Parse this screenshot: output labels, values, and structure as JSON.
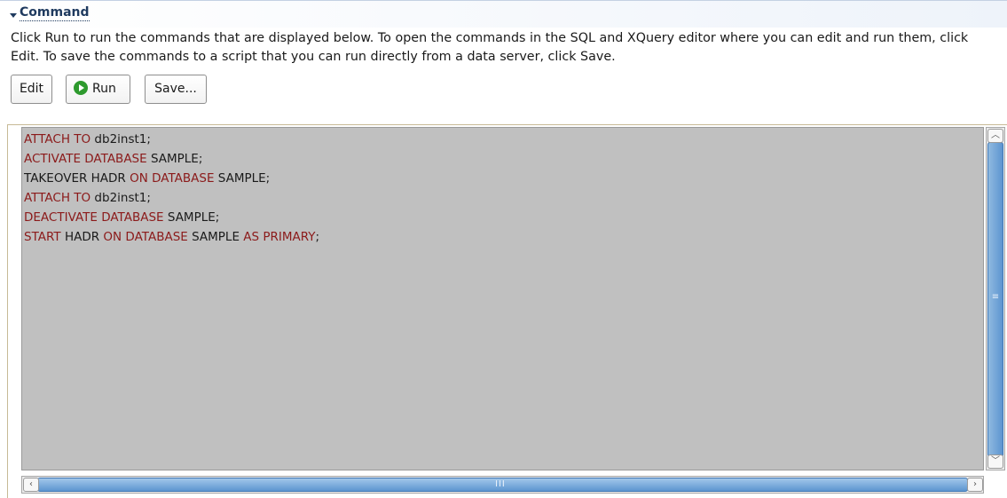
{
  "section": {
    "title": "Command",
    "description": "Click Run to run the commands that are displayed below. To open the commands in the SQL and XQuery editor where you can edit and run them, click Edit. To save the commands to a script that you can run directly from a data server, click Save."
  },
  "buttons": {
    "edit": "Edit",
    "run": "Run",
    "save": "Save..."
  },
  "colors": {
    "keyword": "#8b1a1a",
    "editor_bg": "#c0c0c0",
    "run_icon": "#2e9a2e",
    "header_text": "#1f3a5f"
  },
  "code_lines": [
    [
      {
        "t": "ATTACH TO",
        "k": true
      },
      {
        "t": " db2inst1;",
        "k": false
      }
    ],
    [
      {
        "t": "ACTIVATE DATABASE",
        "k": true
      },
      {
        "t": " SAMPLE;",
        "k": false
      }
    ],
    [
      {
        "t": "TAKEOVER HADR ",
        "k": false
      },
      {
        "t": "ON DATABASE",
        "k": true
      },
      {
        "t": " SAMPLE;",
        "k": false
      }
    ],
    [
      {
        "t": "ATTACH TO",
        "k": true
      },
      {
        "t": " db2inst1;",
        "k": false
      }
    ],
    [
      {
        "t": "DEACTIVATE DATABASE",
        "k": true
      },
      {
        "t": " SAMPLE;",
        "k": false
      }
    ],
    [
      {
        "t": "START",
        "k": true
      },
      {
        "t": " HADR ",
        "k": false
      },
      {
        "t": "ON DATABASE",
        "k": true
      },
      {
        "t": " SAMPLE ",
        "k": false
      },
      {
        "t": "AS PRIMARY",
        "k": true
      },
      {
        "t": ";",
        "k": false
      }
    ]
  ],
  "icons": {
    "section_toggle": "triangle-down-icon",
    "run": "play-circle-icon",
    "scroll_up": "chevron-up-icon",
    "scroll_down": "chevron-down-icon",
    "scroll_left": "chevron-left-icon",
    "scroll_right": "chevron-right-icon"
  }
}
